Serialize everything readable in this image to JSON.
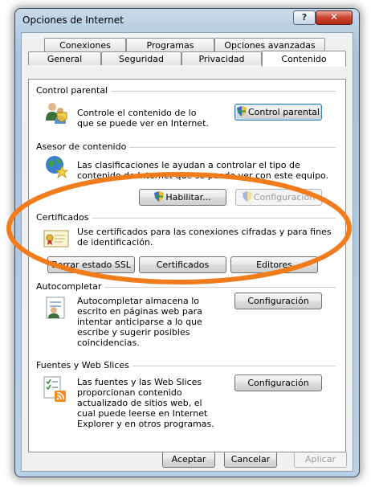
{
  "window": {
    "title": "Opciones de Internet",
    "help_glyph": "?",
    "close_glyph": "✕"
  },
  "tabs_back": [
    "Conexiones",
    "Programas",
    "Opciones avanzadas"
  ],
  "tabs_front": [
    "General",
    "Seguridad",
    "Privacidad",
    "Contenido"
  ],
  "active_tab": "Contenido",
  "sections": {
    "parental": {
      "title": "Control parental",
      "description": "Controle el contenido de lo que se puede ver en Internet.",
      "button": "Control parental"
    },
    "advisor": {
      "title": "Asesor de contenido",
      "description": "Las clasificaciones le ayudan a controlar el tipo de contenido de Internet que se puede ver con este equipo.",
      "enable_button": "Habilitar...",
      "config_button": "Configuración"
    },
    "certificates": {
      "title": "Certificados",
      "description": "Use certificados para las conexiones cifradas y para fines de identificación.",
      "clear_ssl_button": "Borrar estado SSL",
      "certificates_button": "Certificados",
      "publishers_button": "Editores"
    },
    "autocomplete": {
      "title": "Autocompletar",
      "description": "Autocompletar almacena lo escrito en páginas web para intentar anticiparse a lo que escribe y sugerir posibles coincidencias.",
      "config_button": "Configuración"
    },
    "feeds": {
      "title": "Fuentes y Web Slices",
      "description": "Las fuentes y las Web Slices proporcionan contenido actualizado de sitios web, el cual puede leerse en Internet Explorer y en otros programas.",
      "config_button": "Configuración"
    }
  },
  "footer": {
    "accept": "Aceptar",
    "cancel": "Cancelar",
    "apply": "Aplicar"
  },
  "colors": {
    "highlight_ring": "#f07c1c"
  }
}
